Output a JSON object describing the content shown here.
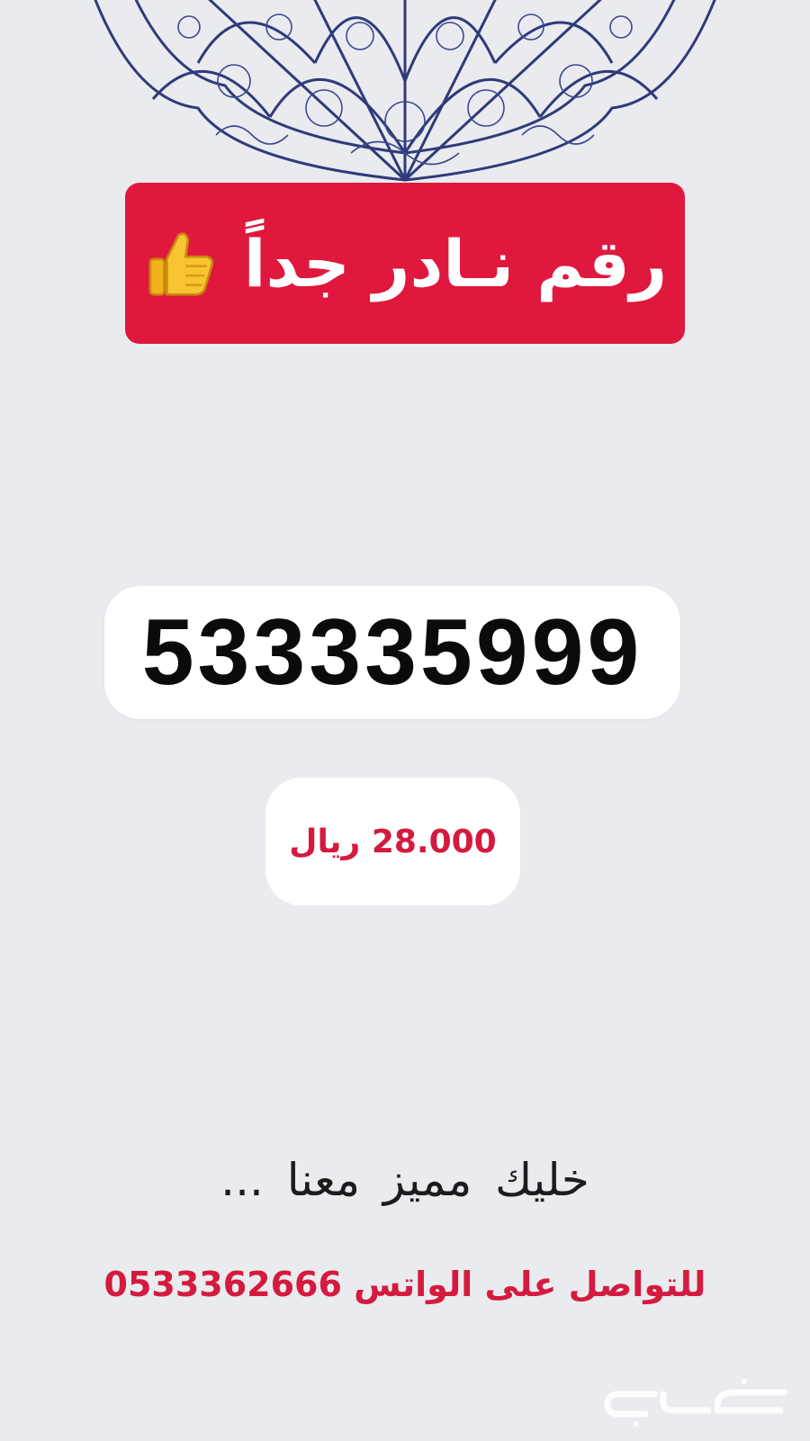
{
  "banner": {
    "text": "رقم نـادر جداً",
    "icon": "thumbs-up-icon"
  },
  "number": {
    "value": "533335999"
  },
  "price": {
    "text": "28.000 ريال"
  },
  "tagline": {
    "text": "خليك مميز معنا ..."
  },
  "contact": {
    "text": "للتواصل على الواتس 0533362666"
  },
  "watermark": {
    "text": "حراج"
  },
  "colors": {
    "background": "#e9ebee",
    "banner": "#e0183d",
    "accent_text": "#d51a3f",
    "ornament": "#2f3a7a"
  }
}
